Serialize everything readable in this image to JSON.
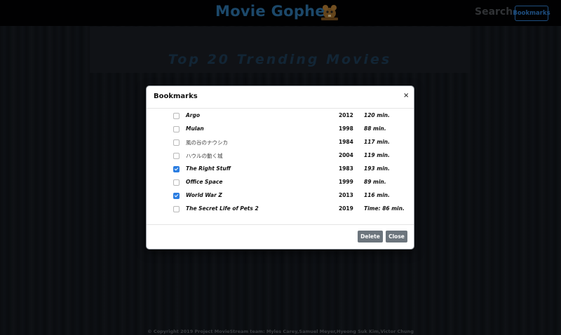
{
  "navbar": {
    "brand": "Movie Gopher",
    "logo_icon": "gopher-logo-icon",
    "search_label": "Search",
    "bookmarks_label": "Bookmarks"
  },
  "hero": {
    "title": "Top 20 Trending Movies"
  },
  "modal": {
    "title": "Bookmarks",
    "close_symbol": "×",
    "rows": [
      {
        "title": "Argo",
        "year": "2012",
        "runtime": "120 min.",
        "checked": false,
        "style": "bold"
      },
      {
        "title": "Mulan",
        "year": "1998",
        "runtime": "88 min.",
        "checked": false,
        "style": "bold"
      },
      {
        "title": "風の谷のナウシカ",
        "year": "1984",
        "runtime": "117 min.",
        "checked": false,
        "style": "plain"
      },
      {
        "title": "ハウルの動く城",
        "year": "2004",
        "runtime": "119 min.",
        "checked": false,
        "style": "plain"
      },
      {
        "title": "The Right Stuff",
        "year": "1983",
        "runtime": "193 min.",
        "checked": true,
        "style": "bold"
      },
      {
        "title": "Office Space",
        "year": "1999",
        "runtime": "89 min.",
        "checked": false,
        "style": "bold"
      },
      {
        "title": "World War Z",
        "year": "2013",
        "runtime": "116 min.",
        "checked": true,
        "style": "bold"
      },
      {
        "title": "The Secret Life of Pets 2",
        "year": "2019",
        "runtime": "Time: 86 min.",
        "checked": false,
        "style": "bold"
      }
    ],
    "delete_label": "Delete",
    "close_label": "Close"
  },
  "footer": {
    "text": "© Copyright 2019 Project MovieStream team: Myles Carey,Samuel Meyer,Hyeong Suk Kim,Victor Chung"
  },
  "colors": {
    "brand": "#2c6fa3",
    "accent": "#2f78c4",
    "checkbox_checked": "#2a7de1",
    "button_gray": "#6c757d"
  }
}
